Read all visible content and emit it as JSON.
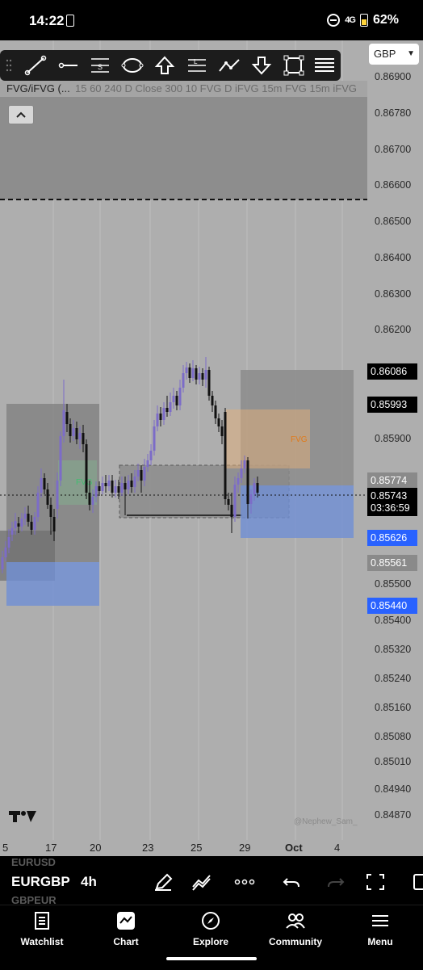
{
  "status_bar": {
    "time": "14:22",
    "signal_text": "4G",
    "battery": "62%"
  },
  "toolbar": {
    "tools": [
      "trend-line-tool",
      "horizontal-ray-tool",
      "long-position-tool",
      "ellipse-tool",
      "arrow-up-tool",
      "fib-retracement-tool",
      "path-tool",
      "arrow-down-tool",
      "rectangle-tool",
      "text-lines-tool"
    ]
  },
  "currency_select": {
    "value": "GBP"
  },
  "indicator": {
    "name": "FVG/iFVG (...",
    "params": "15 60 240 D Close 300 10 FVG D iFVG 15m FVG 15m iFVG"
  },
  "price_scale": [
    "0.86900",
    "0.86780",
    "0.86700",
    "0.86600",
    "0.86500",
    "0.86400",
    "0.86300",
    "0.86200",
    "0.85900",
    "0.85500",
    "0.85400",
    "0.85320",
    "0.85240",
    "0.85160",
    "0.85080",
    "0.85010",
    "0.84940",
    "0.84870"
  ],
  "price_tags": {
    "tag1": "0.86086",
    "tag2": "0.85993",
    "tag3": "0.85774",
    "tag4": "0.85743",
    "countdown": "03:36:59",
    "tag5": "0.85626",
    "tag6": "0.85561",
    "tag7": "0.85440"
  },
  "chart_labels": {
    "fvg_orange": "FVG",
    "fvg_green": "FVG",
    "watermark": "@Nephew_Sam_"
  },
  "x_axis": [
    "5",
    "17",
    "20",
    "23",
    "25",
    "29",
    "Oct",
    "4"
  ],
  "symbol_bar": {
    "prev_symbol": "EURUSD",
    "symbol": "EURGBP",
    "timeframe": "4h",
    "next_symbol": "GBPEUR"
  },
  "bottom_nav": [
    {
      "label": "Watchlist",
      "icon": "watchlist-icon"
    },
    {
      "label": "Chart",
      "icon": "chart-icon"
    },
    {
      "label": "Explore",
      "icon": "compass-icon"
    },
    {
      "label": "Community",
      "icon": "community-icon"
    },
    {
      "label": "Menu",
      "icon": "menu-icon"
    }
  ],
  "colors": {
    "chart_bg": "#aeaeae",
    "fvg_blue": "#6f8ed4",
    "fvg_orange": "#e3a86a",
    "candle_up": "#7c6cc8",
    "candle_down": "#111111",
    "accent_blue": "#2962ff"
  }
}
